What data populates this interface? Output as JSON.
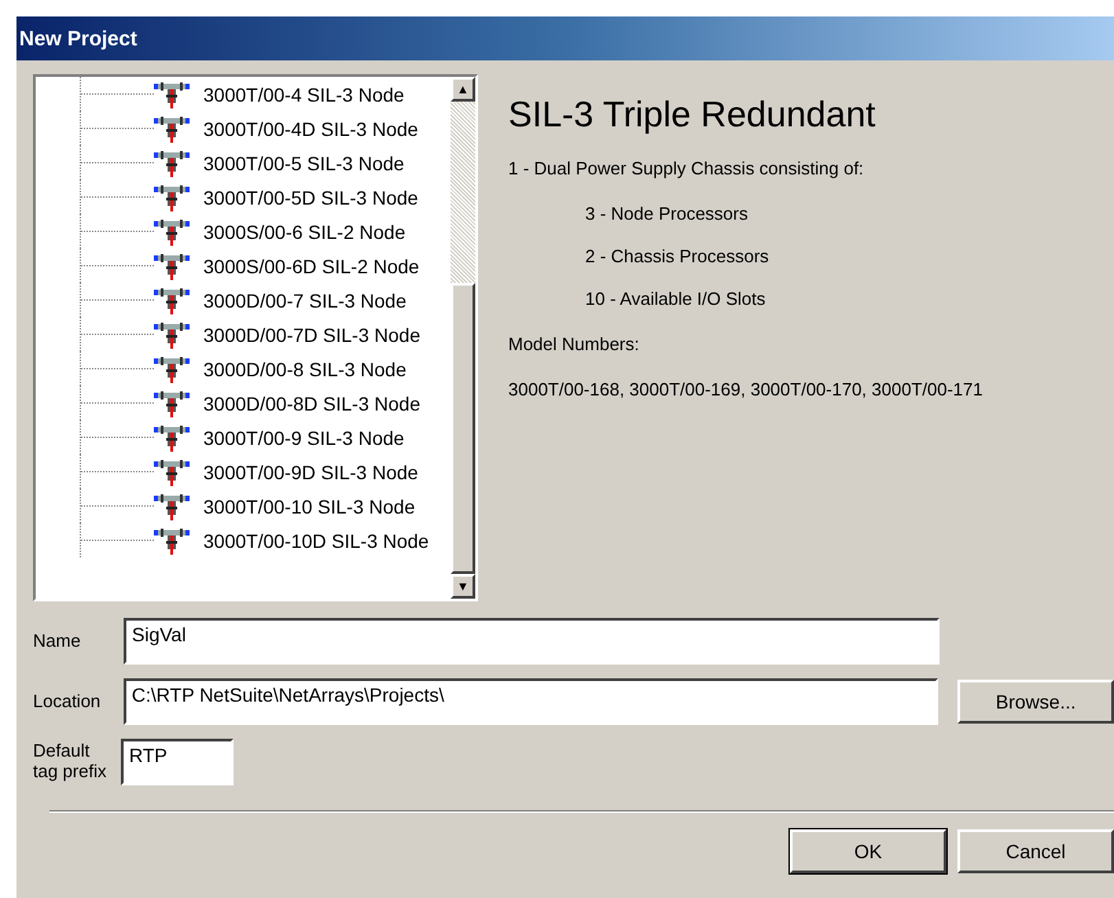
{
  "window": {
    "title": "New Project"
  },
  "tree": {
    "items": [
      {
        "label": "3000T/00-4 SIL-3 Node"
      },
      {
        "label": "3000T/00-4D SIL-3 Node"
      },
      {
        "label": "3000T/00-5 SIL-3 Node"
      },
      {
        "label": "3000T/00-5D SIL-3 Node"
      },
      {
        "label": "3000S/00-6 SIL-2 Node"
      },
      {
        "label": "3000S/00-6D SIL-2 Node"
      },
      {
        "label": "3000D/00-7 SIL-3 Node"
      },
      {
        "label": "3000D/00-7D SIL-3 Node"
      },
      {
        "label": "3000D/00-8 SIL-3 Node"
      },
      {
        "label": "3000D/00-8D SIL-3 Node"
      },
      {
        "label": "3000T/00-9 SIL-3 Node"
      },
      {
        "label": "3000T/00-9D SIL-3 Node"
      },
      {
        "label": "3000T/00-10 SIL-3 Node"
      },
      {
        "label": "3000T/00-10D SIL-3 Node"
      }
    ],
    "scroll_up": "▲",
    "scroll_down": "▼"
  },
  "details": {
    "heading": "SIL-3 Triple Redundant",
    "intro": "1 - Dual Power Supply Chassis consisting of:",
    "components": [
      "3 - Node Processors",
      "2 - Chassis Processors",
      "10 - Available I/O Slots"
    ],
    "model_label": "Model Numbers:",
    "models": "3000T/00-168, 3000T/00-169, 3000T/00-170, 3000T/00-171"
  },
  "fields": [
    {
      "label": "Name",
      "value": "SigVal"
    },
    {
      "label": "Location",
      "value": "C:\\RTP NetSuite\\NetArrays\\Projects\\"
    },
    {
      "label": "Default tag prefix",
      "value": "RTP"
    }
  ],
  "browse_button": "Browse...",
  "buttons": [
    "OK",
    "Cancel"
  ]
}
